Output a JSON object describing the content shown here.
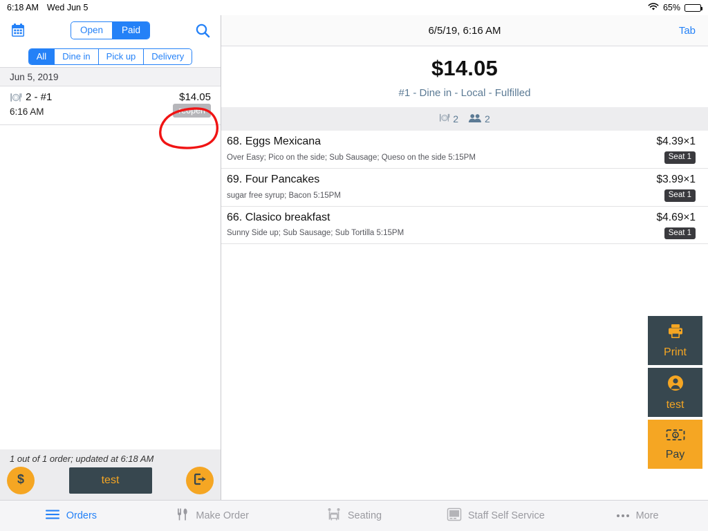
{
  "statusbar": {
    "time": "6:18 AM",
    "date": "Wed Jun 5",
    "battery_pct": "65%",
    "wifi_icon": "wifi-icon",
    "battery_icon": "battery-icon"
  },
  "left_panel": {
    "calendar_icon": "calendar-icon",
    "search_icon": "search-icon",
    "status_segment": {
      "options": [
        "Open",
        "Paid"
      ],
      "selected": "Paid"
    },
    "type_filters": {
      "options": [
        "All",
        "Dine in",
        "Pick up",
        "Delivery"
      ],
      "selected": "All"
    },
    "date_header": "Jun 5, 2019",
    "orders": [
      {
        "table_icon": "table-setting-icon",
        "title": "2 - #1",
        "amount": "$14.05",
        "time": "6:16 AM",
        "action_label": "reopen"
      }
    ],
    "footer": {
      "status_text": "1 out of 1 order; updated at 6:18 AM",
      "cash_icon": "dollar-icon",
      "user_label": "test",
      "logout_icon": "logout-icon"
    }
  },
  "right_panel": {
    "topbar": {
      "datetime": "6/5/19, 6:16 AM",
      "tab_label": "Tab"
    },
    "summary": {
      "total": "$14.05",
      "subtitle": "#1 - Dine in - Local - Fulfilled"
    },
    "counts": {
      "table_icon": "table-setting-icon",
      "table_count": "2",
      "guests_icon": "people-icon",
      "guest_count": "2"
    },
    "items": [
      {
        "name": "68. Eggs Mexicana",
        "price": "$4.39×1",
        "modifiers": "Over Easy;  Pico on the side;  Sub Sausage;  Queso on the side   5:15PM",
        "seat": "Seat 1"
      },
      {
        "name": "69. Four Pancakes",
        "price": "$3.99×1",
        "modifiers": "sugar free syrup;  Bacon   5:15PM",
        "seat": "Seat 1"
      },
      {
        "name": "66. Clasico breakfast",
        "price": "$4.69×1",
        "modifiers": "Sunny Side up;  Sub Sausage;  Sub Tortilla   5:15PM",
        "seat": "Seat 1"
      }
    ],
    "actions": [
      {
        "label": "Print",
        "icon": "printer-icon",
        "style": "dark"
      },
      {
        "label": "test",
        "icon": "person-icon",
        "style": "dark"
      },
      {
        "label": "Pay",
        "icon": "cash-icon",
        "style": "accent"
      }
    ]
  },
  "bottom_nav": [
    {
      "label": "Orders",
      "icon": "list-icon",
      "active": true
    },
    {
      "label": "Make Order",
      "icon": "cutlery-icon",
      "active": false
    },
    {
      "label": "Seating",
      "icon": "seating-icon",
      "active": false
    },
    {
      "label": "Staff Self Service",
      "icon": "monitor-icon",
      "active": false
    },
    {
      "label": "More",
      "icon": "ellipsis-icon",
      "active": false
    }
  ],
  "annotation": {
    "shape": "hand-drawn-ellipse",
    "color": "#f01414",
    "target": "reopen"
  },
  "colors": {
    "accent_blue": "#2481f7",
    "accent_orange": "#f5a623",
    "dark_slate": "#37474f",
    "annotation_red": "#f01414"
  }
}
